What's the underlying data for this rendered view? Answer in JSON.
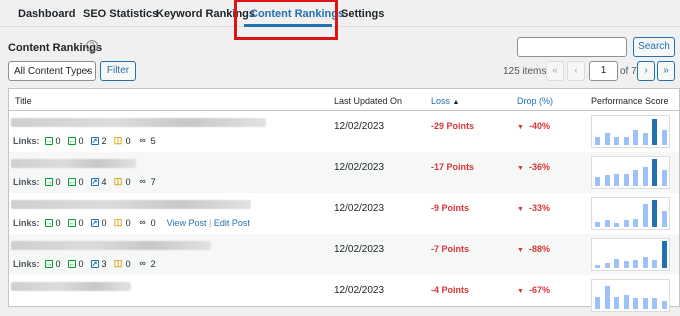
{
  "tabs": [
    {
      "label": "Dashboard",
      "active": false
    },
    {
      "label": "SEO Statistics",
      "active": false
    },
    {
      "label": "Keyword Rankings",
      "active": false
    },
    {
      "label": "Content Rankings",
      "active": true
    },
    {
      "label": "Settings",
      "active": false
    }
  ],
  "section": {
    "title": "Content Rankings",
    "help_icon": "question-circle-icon"
  },
  "search": {
    "value": "",
    "button_label": "Search"
  },
  "filter": {
    "select_value": "All Content Types",
    "button_label": "Filter"
  },
  "pagination": {
    "items_text": "125 items",
    "first": "«",
    "prev": "‹",
    "current_page": "1",
    "of_text": "of 7",
    "next": "›",
    "last": "»"
  },
  "table": {
    "columns": {
      "title": "Title",
      "updated": "Last Updated On",
      "loss": "Loss",
      "drop": "Drop (%)",
      "score": "Performance Score"
    },
    "sort_indicator": "▲",
    "links_label": "Links:",
    "view_post": "View Post",
    "edit_post": "Edit Post",
    "row_sep": "|",
    "rows": [
      {
        "inbound": "0",
        "outbound": "0",
        "internal": "2",
        "affiliate": "0",
        "external": "5",
        "date": "12/02/2023",
        "loss": "-29 Points",
        "drop": "-40%",
        "bars": [
          0.3,
          0.45,
          0.3,
          0.3,
          0.55,
          0.45,
          0.95,
          0.55
        ]
      },
      {
        "inbound": "0",
        "outbound": "0",
        "internal": "4",
        "affiliate": "0",
        "external": "7",
        "date": "12/02/2023",
        "loss": "-17 Points",
        "drop": "-36%",
        "bars": [
          0.35,
          0.4,
          0.45,
          0.45,
          0.6,
          0.7,
          1.0,
          0.6
        ]
      },
      {
        "inbound": "0",
        "outbound": "0",
        "internal": "0",
        "affiliate": "0",
        "external": "0",
        "date": "12/02/2023",
        "loss": "-9 Points",
        "drop": "-33%",
        "bars": [
          0.2,
          0.25,
          0.15,
          0.25,
          0.3,
          0.85,
          1.0,
          0.6
        ]
      },
      {
        "inbound": "0",
        "outbound": "0",
        "internal": "3",
        "affiliate": "0",
        "external": "2",
        "date": "12/02/2023",
        "loss": "-7 Points",
        "drop": "-88%",
        "bars": [
          0.1,
          0.2,
          0.35,
          0.25,
          0.3,
          0.4,
          0.3,
          1.0
        ]
      },
      {
        "inbound": "",
        "outbound": "",
        "internal": "",
        "affiliate": "",
        "external": "",
        "date": "12/02/2023",
        "loss": "-4 Points",
        "drop": "-67%",
        "bars": [
          0.45,
          0.85,
          0.45,
          0.5,
          0.4,
          0.4,
          0.4,
          0.3
        ]
      }
    ]
  }
}
